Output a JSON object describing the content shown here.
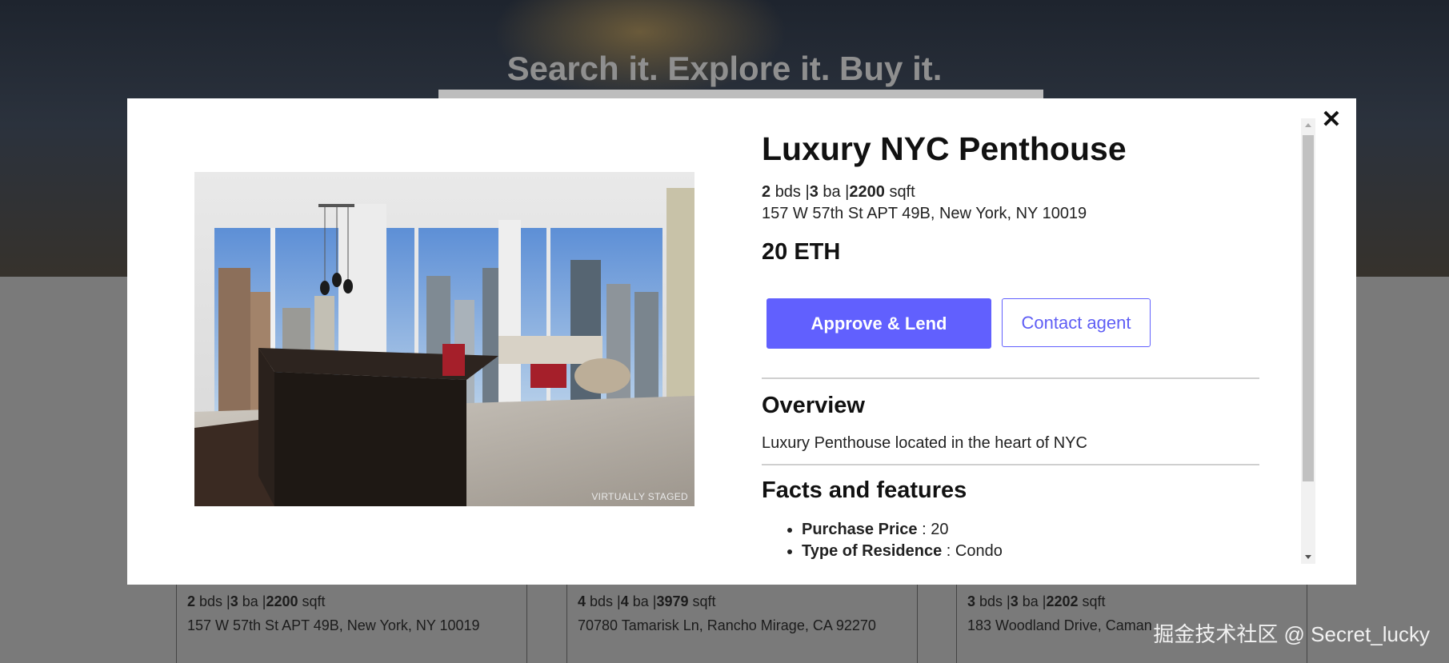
{
  "background": {
    "hero_title": "Search it. Explore it. Buy it.",
    "cards": [
      {
        "beds": "2",
        "baths": "3",
        "sqft": "2200",
        "address": "157 W 57th St APT 49B, New York, NY 10019"
      },
      {
        "beds": "4",
        "baths": "4",
        "sqft": "3979",
        "address": "70780 Tamarisk Ln, Rancho Mirage, CA 92270"
      },
      {
        "beds": "3",
        "baths": "3",
        "sqft": "2202",
        "address": "183 Woodland Drive, Caman"
      }
    ],
    "labels": {
      "bds": "bds |",
      "ba": "ba |",
      "sqft": "sqft"
    }
  },
  "watermark": "掘金技术社区 @ Secret_lucky",
  "modal": {
    "close_icon": "✕",
    "photo_caption": "VIRTUALLY STAGED",
    "title": "Luxury NYC Penthouse",
    "beds": "2",
    "beds_label": "bds |",
    "baths": "3",
    "baths_label": "ba |",
    "sqft": "2200",
    "sqft_label": "sqft",
    "address": "157 W 57th St APT 49B, New York, NY 10019",
    "price": "20 ETH",
    "primary_button": "Approve & Lend",
    "secondary_button": "Contact agent",
    "overview_heading": "Overview",
    "overview_text": "Luxury Penthouse located in the heart of NYC",
    "facts_heading": "Facts and features",
    "facts": [
      {
        "label": "Purchase Price",
        "value": " : 20"
      },
      {
        "label": "Type of Residence",
        "value": " : Condo"
      }
    ],
    "accent_color": "#6160fe"
  }
}
